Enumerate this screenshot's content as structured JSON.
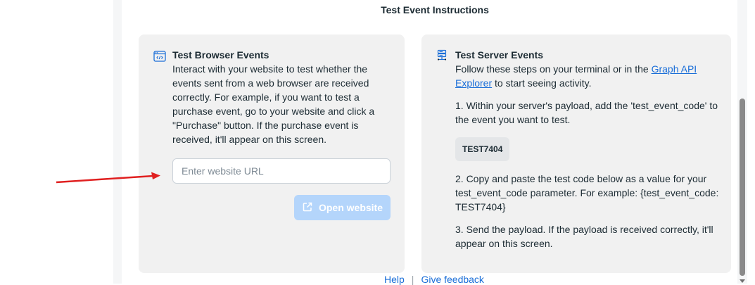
{
  "page": {
    "title": "Test Event Instructions"
  },
  "browser_card": {
    "icon": "code-window-icon",
    "title": "Test Browser Events",
    "body_lines": [
      "Interact with your website to test whether the",
      "events sent from a web browser are received",
      "correctly. For example, if you want to test a",
      "purchase event, go to your website and click a",
      "\"Purchase\" button. If the purchase event is",
      "received, it'll appear on this screen."
    ],
    "input_placeholder": "Enter website URL",
    "input_value": "",
    "open_button_label": "Open website",
    "open_button_icon": "external-link-icon"
  },
  "server_card": {
    "icon": "server-icon",
    "title": "Test Server Events",
    "intro_line1_prefix": "Follow these steps on your terminal or in the ",
    "intro_link_part1": "Graph API",
    "intro_link_part2": "Explorer",
    "intro_line2_suffix": " to start seeing activity.",
    "step1_lines": [
      "1. Within your server's payload, add the 'test_event_code' to",
      "the event you want to test."
    ],
    "test_code": "TEST7404",
    "step2_lines": [
      "2. Copy and paste the test code below as a value for your",
      "test_event_code parameter. For example: {test_event_code:",
      "TEST7404}"
    ],
    "step3_lines": [
      "3. Send the payload. If the payload is received correctly, it'll",
      "appear on this screen."
    ]
  },
  "footer": {
    "help": "Help",
    "separator": "|",
    "feedback": "Give feedback"
  },
  "colors": {
    "accent": "#1a6ed8",
    "annotation_arrow": "#e02020",
    "button_disabled": "#b4d5fb",
    "card_bg": "#f1f1f1"
  }
}
